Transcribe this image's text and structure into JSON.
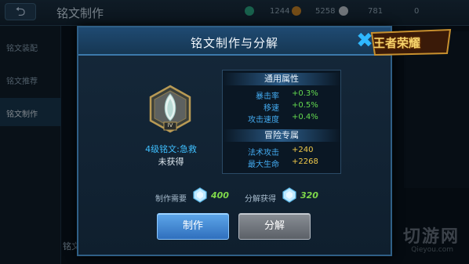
{
  "background": {
    "title": "铭文制作",
    "resources": [
      "1244",
      "5258",
      "781",
      "0"
    ],
    "sidebar": [
      "铭文装配",
      "铭文推荐",
      "铭文制作"
    ],
    "bottom_label": "铭文",
    "watermark": "切游网",
    "watermark_sub": "Qieyou.com"
  },
  "logo": {
    "text": "王者荣耀"
  },
  "dialog": {
    "title": "铭文制作与分解",
    "rune": {
      "level": "IV",
      "name": "4级铭文:急救",
      "status": "未获得"
    },
    "attributes": {
      "general_header": "通用属性",
      "general": [
        {
          "name": "暴击率",
          "value": "+0.3%"
        },
        {
          "name": "移速",
          "value": "+0.5%"
        },
        {
          "name": "攻击速度",
          "value": "+0.4%"
        }
      ],
      "adventure_header": "冒险专属",
      "adventure": [
        {
          "name": "法术攻击",
          "value": "+240"
        },
        {
          "name": "最大生命",
          "value": "+2268"
        }
      ]
    },
    "cost": {
      "make_label": "制作需要",
      "make_value": "400",
      "decompose_label": "分解获得",
      "decompose_value": "320"
    },
    "buttons": {
      "make": "制作",
      "decompose": "分解"
    }
  },
  "colors": {
    "accent_blue": "#3fc0ff",
    "value_green": "#63d94f",
    "value_gold": "#f0c94a"
  }
}
